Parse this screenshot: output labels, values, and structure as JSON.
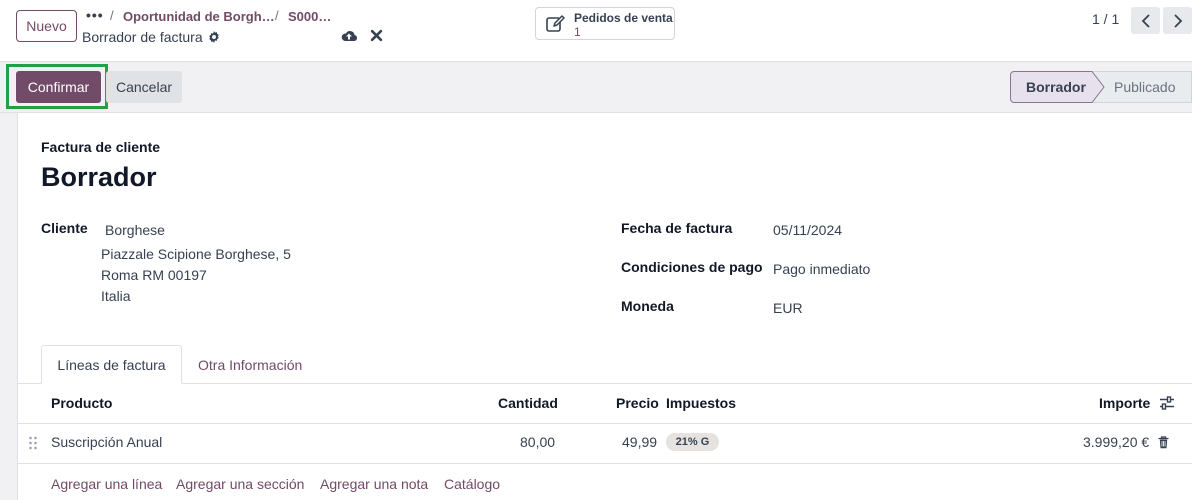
{
  "header": {
    "new_button": "Nuevo",
    "breadcrumb_more": "•••",
    "breadcrumb": [
      "Oportunidad de Borgh…",
      "S000…"
    ],
    "breadcrumb_separator": "/",
    "record_title": "Borrador de factura",
    "smart_button": {
      "label": "Pedidos de venta",
      "value": "1"
    },
    "pager": "1 / 1"
  },
  "actions": {
    "confirm": "Confirmar",
    "cancel": "Cancelar"
  },
  "statusbar": {
    "stages": [
      "Borrador",
      "Publicado"
    ],
    "active": "Borrador"
  },
  "form": {
    "subtitle": "Factura de cliente",
    "state_title": "Borrador",
    "customer_label": "Cliente",
    "customer_name": "Borghese",
    "address": [
      "Piazzale Scipione Borghese, 5",
      "Roma RM 00197",
      "Italia"
    ],
    "invoice_date_label": "Fecha de factura",
    "invoice_date": "05/11/2024",
    "payment_terms_label": "Condiciones de pago",
    "payment_terms": "Pago inmediato",
    "currency_label": "Moneda",
    "currency": "EUR"
  },
  "tabs": [
    {
      "label": "Líneas de factura",
      "active": true
    },
    {
      "label": "Otra Información",
      "active": false
    }
  ],
  "table": {
    "columns": [
      "Producto",
      "Cantidad",
      "Precio",
      "Impuestos",
      "Importe"
    ],
    "rows": [
      {
        "product": "Suscripción Anual",
        "quantity": "80,00",
        "price": "49,99",
        "tax": "21% G",
        "amount": "3.999,20 €"
      }
    ],
    "add_links": [
      "Agregar una línea",
      "Agregar una sección",
      "Agregar una nota",
      "Catálogo"
    ]
  },
  "colors": {
    "brand": "#714b67",
    "highlight": "#22a046",
    "status_active": "#e7e1ee"
  },
  "icons": [
    "gear-icon",
    "cloud-upload-icon",
    "close-icon",
    "edit-icon",
    "chevron-left-icon",
    "chevron-right-icon",
    "drag-handle-icon",
    "trash-icon",
    "settings-sliders-icon"
  ]
}
